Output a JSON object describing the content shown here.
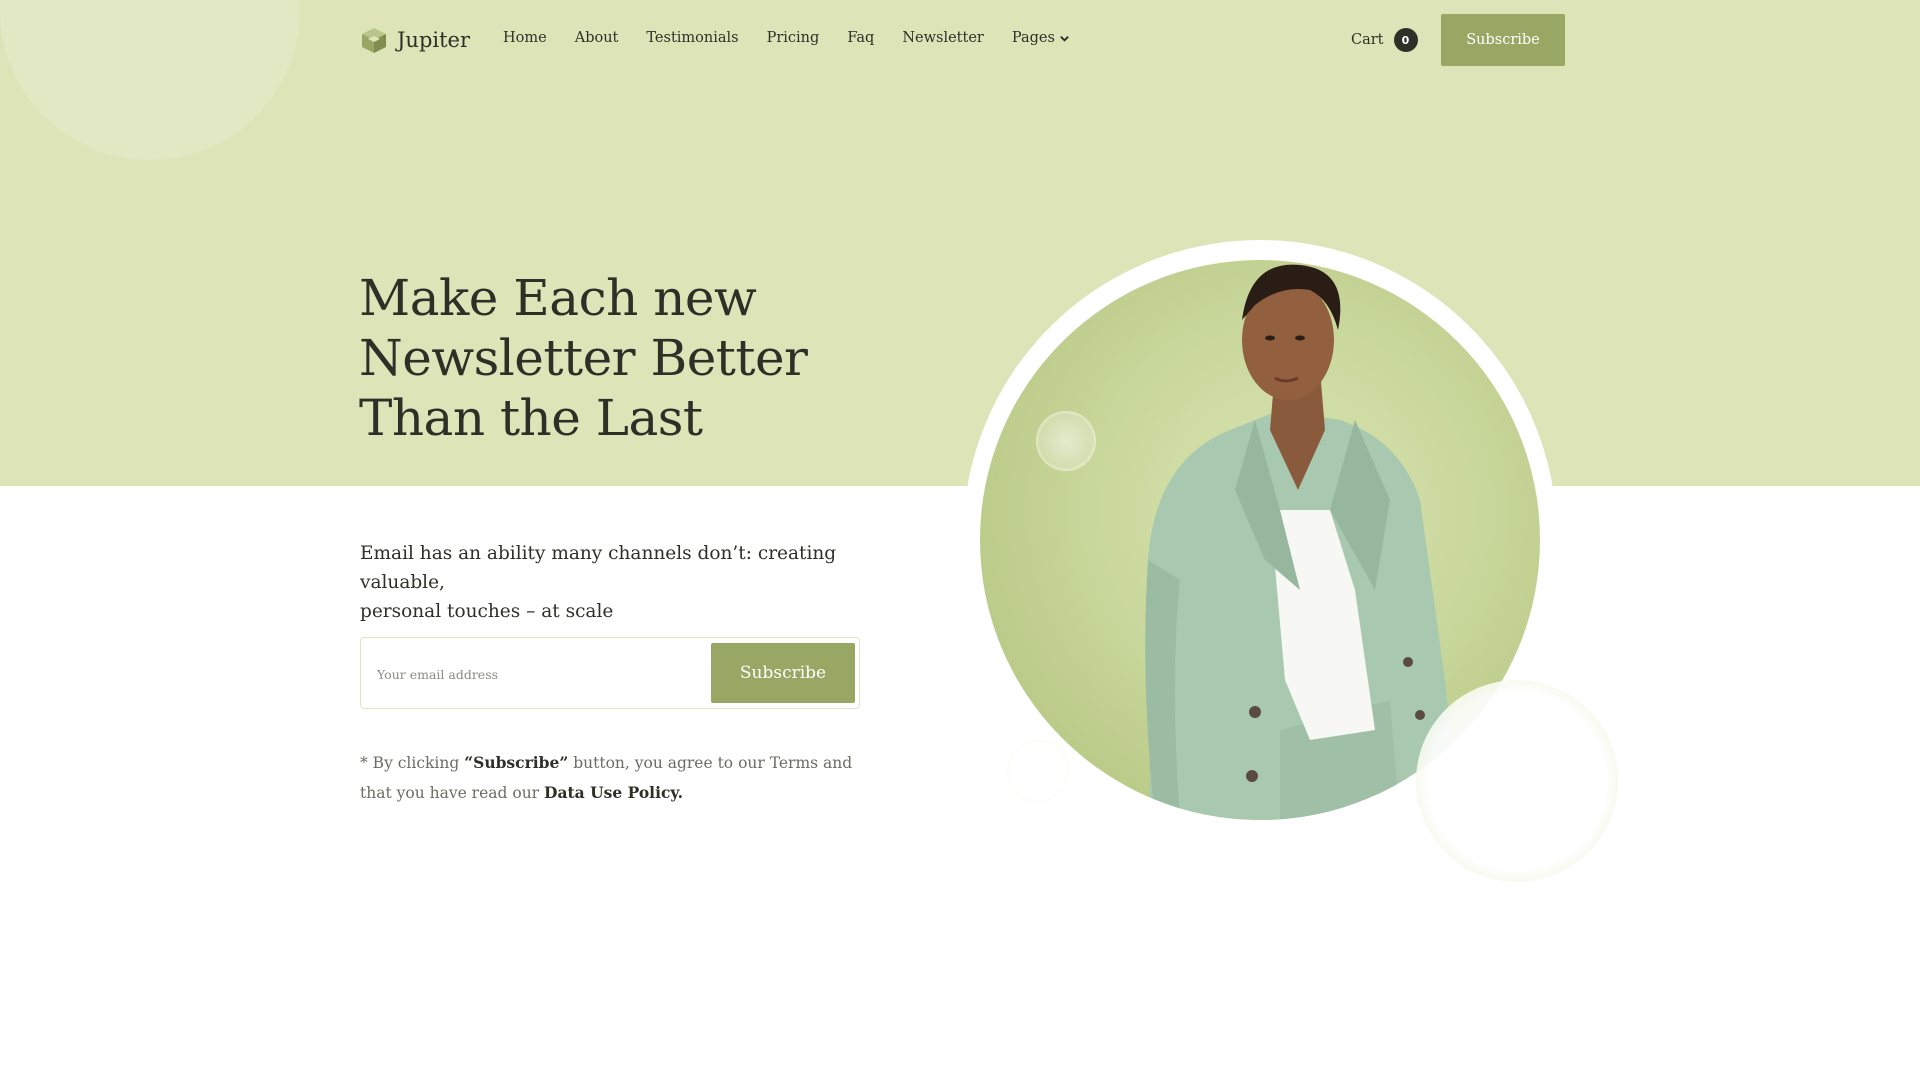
{
  "brand": {
    "name": "Jupiter",
    "icon": "cube-logo-icon"
  },
  "nav": {
    "items": [
      {
        "label": "Home"
      },
      {
        "label": "About"
      },
      {
        "label": "Testimonials"
      },
      {
        "label": "Pricing"
      },
      {
        "label": "Faq"
      },
      {
        "label": "Newsletter"
      },
      {
        "label": "Pages",
        "icon": "chevron-down-icon"
      }
    ]
  },
  "cart": {
    "label": "Cart",
    "count": "0"
  },
  "header": {
    "subscribe_label": "Subscribe"
  },
  "hero": {
    "headline_lines": [
      "Make Each new",
      "Newsletter Better",
      "Than the Last"
    ],
    "subtext_line1": "Email has an ability many channels don’t: creating valuable,",
    "subtext_line2": "personal touches – at scale",
    "email_placeholder": "Your email address",
    "form_button": "Subscribe",
    "disclaimer": {
      "prefix": "* By clicking ",
      "bold1": "“Subscribe”",
      "middle": " button, you agree to our Terms and that you have read our ",
      "bold2": "Data Use Policy."
    },
    "portrait_alt": "portrait-photo"
  },
  "colors": {
    "hero_bg": "#dde5b8",
    "accent": "#98a763",
    "text": "#2e3028",
    "jacket": "#a9c8b0"
  }
}
